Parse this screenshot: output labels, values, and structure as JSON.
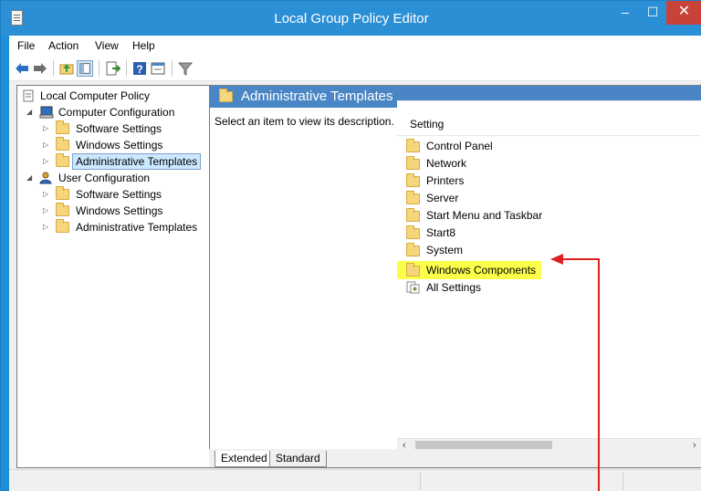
{
  "window": {
    "title": "Local Group Policy Editor",
    "minimize": "–",
    "maximize": "☐",
    "close": "✕"
  },
  "menu": [
    "File",
    "Action",
    "View",
    "Help"
  ],
  "tree": {
    "root": "Local Computer Policy",
    "computer_config": "Computer Configuration",
    "computer_children": [
      "Software Settings",
      "Windows Settings",
      "Administrative Templates"
    ],
    "user_config": "User Configuration",
    "user_children": [
      "Software Settings",
      "Windows Settings",
      "Administrative Templates"
    ]
  },
  "main": {
    "title": "Administrative Templates",
    "description": "Select an item to view its description.",
    "column_header": "Setting",
    "items": [
      "Control Panel",
      "Network",
      "Printers",
      "Server",
      "Start Menu and Taskbar",
      "Start8",
      "System",
      "Windows Components",
      "All Settings"
    ],
    "highlighted_item": "Windows Components"
  },
  "tabs": [
    "Extended",
    "Standard"
  ],
  "colors": {
    "titlebar": "#2b8fd6",
    "highlight": "#fbff4a",
    "annotation": "#e01f1f",
    "header": "#4a86c5"
  }
}
